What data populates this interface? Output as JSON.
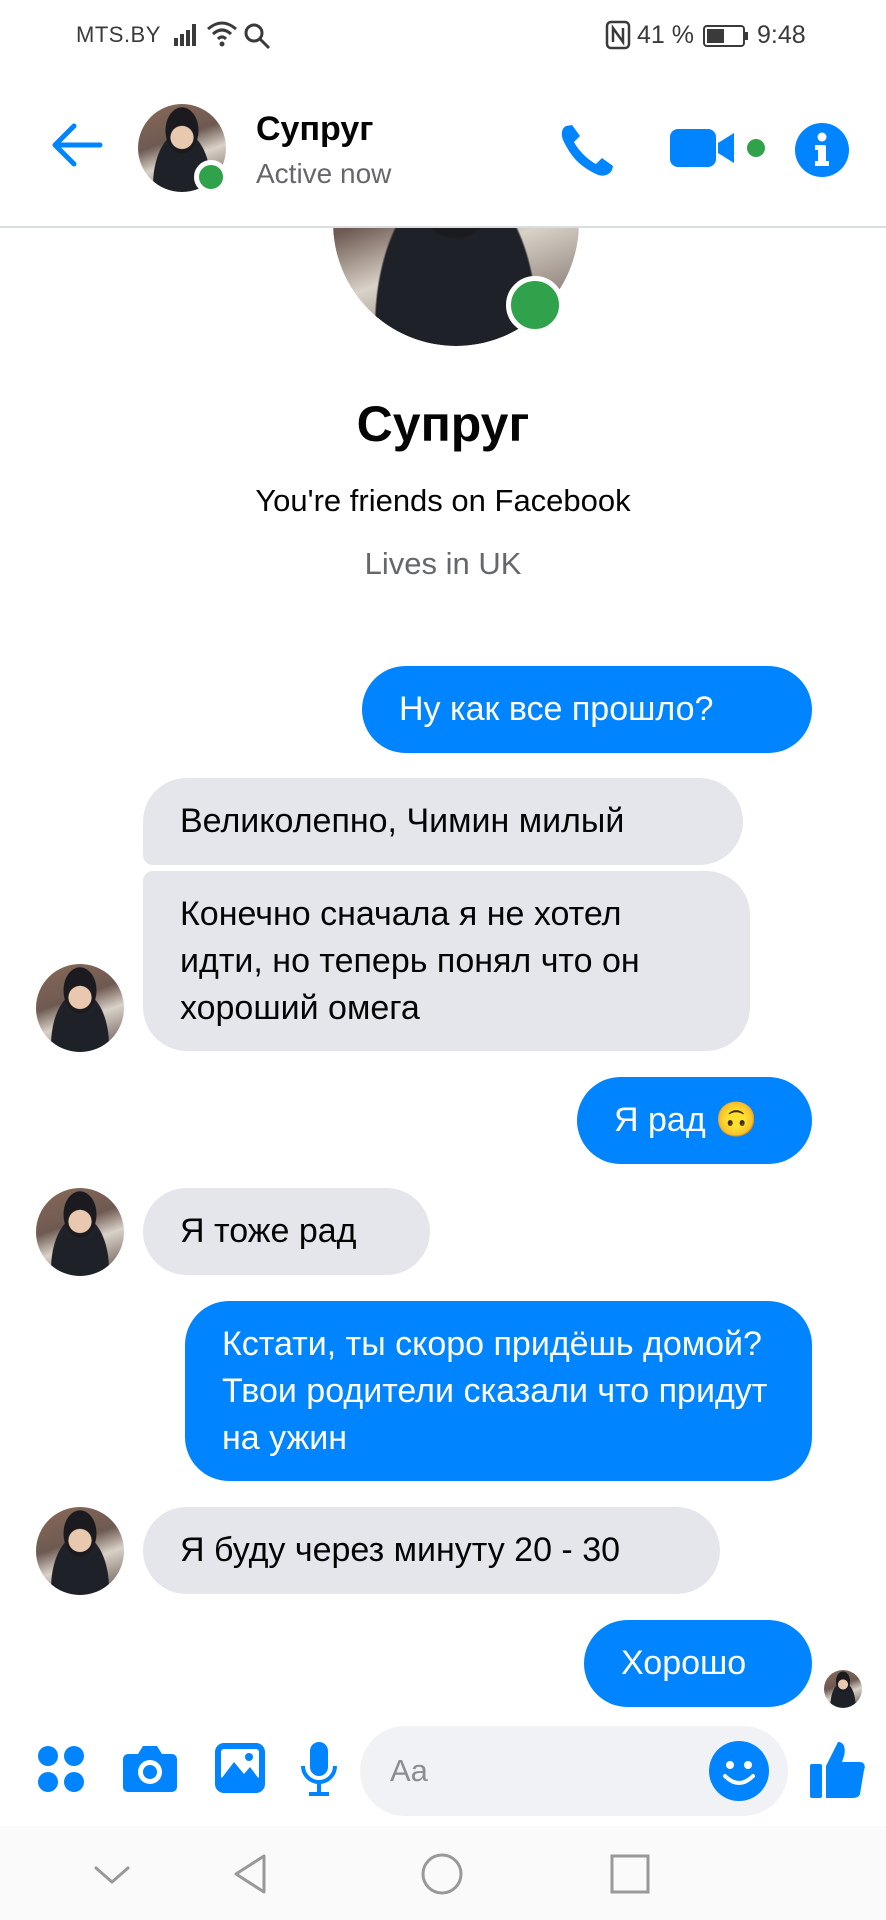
{
  "status_bar": {
    "carrier": "MTS.BY",
    "battery_percent": "41 %",
    "time": "9:48"
  },
  "header": {
    "contact_name": "Супруг",
    "status": "Active now"
  },
  "profile": {
    "name": "Супруг",
    "friends_text": "You're friends on Facebook",
    "lives_text": "Lives in UK"
  },
  "messages": [
    {
      "direction": "outgoing",
      "text": "Ну как все прошло?"
    },
    {
      "direction": "incoming",
      "text": "Великолепно, Чимин милый"
    },
    {
      "direction": "incoming",
      "text": "Конечно сначала я не хотел идти, но теперь понял что он хороший омега"
    },
    {
      "direction": "outgoing",
      "text": "Я рад 🙃"
    },
    {
      "direction": "incoming",
      "text": "Я тоже рад"
    },
    {
      "direction": "outgoing",
      "text": "Кстати, ты скоро придёшь домой? Твои родители сказали что придут на ужин"
    },
    {
      "direction": "incoming",
      "text": "Я буду через минуту 20 - 30"
    },
    {
      "direction": "outgoing",
      "text": "Хорошо"
    }
  ],
  "composer": {
    "placeholder": "Aa"
  },
  "icons": {
    "accent": "#0084ff",
    "online": "#31a24c",
    "incoming_bubble": "#e4e6eb"
  }
}
